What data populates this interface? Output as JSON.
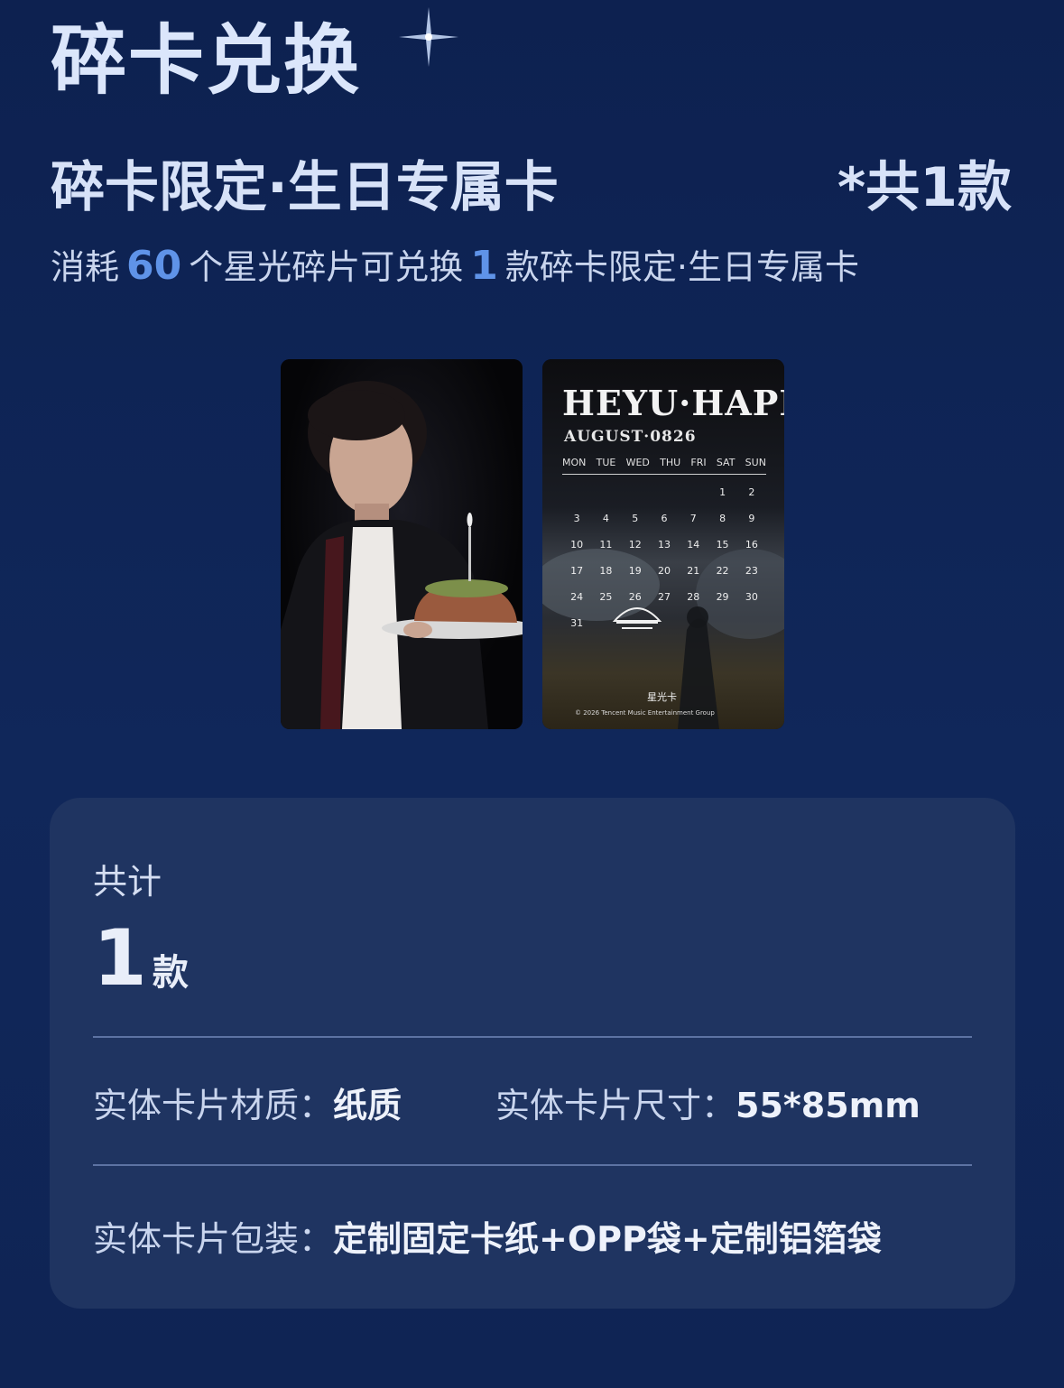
{
  "header": {
    "title": "碎卡兑换",
    "subtitle": "碎卡限定·生日专属卡",
    "count_tag": "*共1款"
  },
  "description": {
    "prefix": "消耗",
    "cost": "60",
    "middle": "个星光碎片可兑换",
    "quantity": "1",
    "suffix": "款碎卡限定·生日专属卡"
  },
  "cards": {
    "calendar": {
      "title": "HEYU·HAPPY",
      "month": "AUGUST·0826",
      "weekdays": [
        "MON",
        "TUE",
        "WED",
        "THU",
        "FRI",
        "SAT",
        "SUN"
      ],
      "days": [
        "",
        "",
        "",
        "",
        "",
        "1",
        "2",
        "3",
        "4",
        "5",
        "6",
        "7",
        "8",
        "9",
        "10",
        "11",
        "12",
        "13",
        "14",
        "15",
        "16",
        "17",
        "18",
        "19",
        "20",
        "21",
        "22",
        "23",
        "24",
        "25",
        "26",
        "27",
        "28",
        "29",
        "30",
        "31"
      ],
      "brand": "星光卡",
      "copyright": "© 2026 Tencent Music Entertainment Group"
    }
  },
  "summary": {
    "label": "共计",
    "total_number": "1",
    "total_unit": "款",
    "material_label": "实体卡片材质：",
    "material_value": "纸质",
    "size_label": "实体卡片尺寸：",
    "size_value": "55*85mm",
    "packaging_label": "实体卡片包装：",
    "packaging_value": "定制固定卡纸+OPP袋+定制铝箔袋"
  },
  "colors": {
    "background": "#0e2250",
    "panel": "#1f3461",
    "accent": "#5f93e8"
  }
}
